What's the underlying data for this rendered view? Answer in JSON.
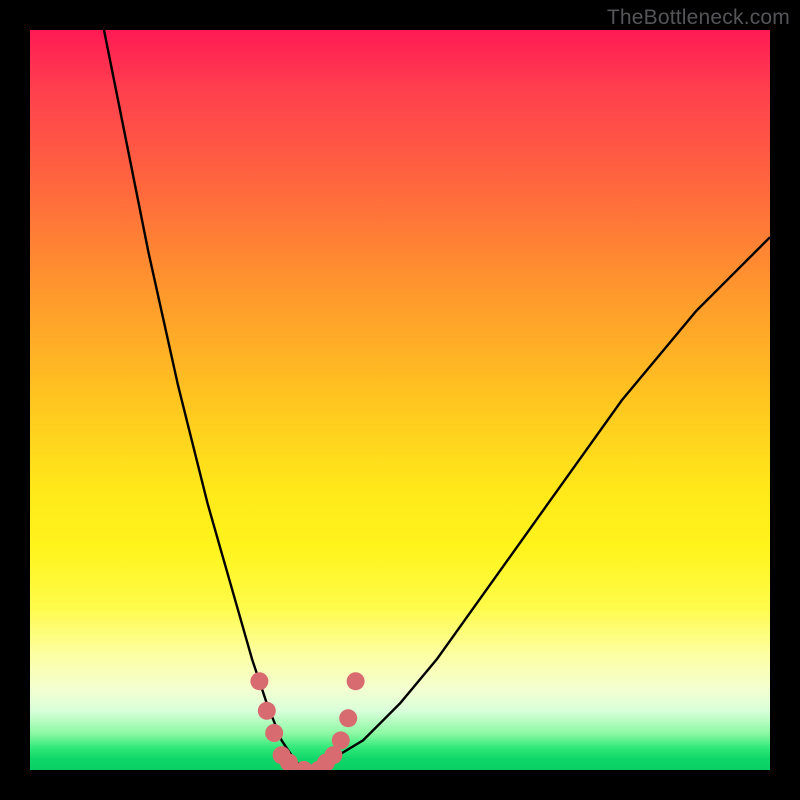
{
  "watermark": "TheBottleneck.com",
  "colors": {
    "background": "#000000",
    "gradient_top": "#ff1a54",
    "gradient_mid": "#ffe81a",
    "gradient_bottom": "#09cf63",
    "curve": "#000000",
    "marker": "#d86b6f"
  },
  "chart_data": {
    "type": "line",
    "title": "",
    "xlabel": "",
    "ylabel": "",
    "xlim": [
      0,
      100
    ],
    "ylim": [
      0,
      100
    ],
    "series": [
      {
        "name": "bottleneck-curve",
        "x": [
          10,
          12,
          14,
          16,
          18,
          20,
          22,
          24,
          26,
          28,
          30,
          32,
          34,
          36,
          38,
          40,
          45,
          50,
          55,
          60,
          65,
          70,
          75,
          80,
          85,
          90,
          95,
          100
        ],
        "y": [
          100,
          90,
          80,
          70,
          61,
          52,
          44,
          36,
          29,
          22,
          15,
          9,
          4,
          1,
          0,
          1,
          4,
          9,
          15,
          22,
          29,
          36,
          43,
          50,
          56,
          62,
          67,
          72
        ]
      }
    ],
    "markers": {
      "name": "highlight-dots",
      "color": "#d86b6f",
      "points": [
        {
          "x": 31,
          "y": 12
        },
        {
          "x": 32,
          "y": 8
        },
        {
          "x": 33,
          "y": 5
        },
        {
          "x": 34,
          "y": 2
        },
        {
          "x": 35,
          "y": 1
        },
        {
          "x": 37,
          "y": 0
        },
        {
          "x": 39,
          "y": 0
        },
        {
          "x": 40,
          "y": 1
        },
        {
          "x": 41,
          "y": 2
        },
        {
          "x": 42,
          "y": 4
        },
        {
          "x": 43,
          "y": 7
        },
        {
          "x": 44,
          "y": 12
        }
      ]
    }
  }
}
